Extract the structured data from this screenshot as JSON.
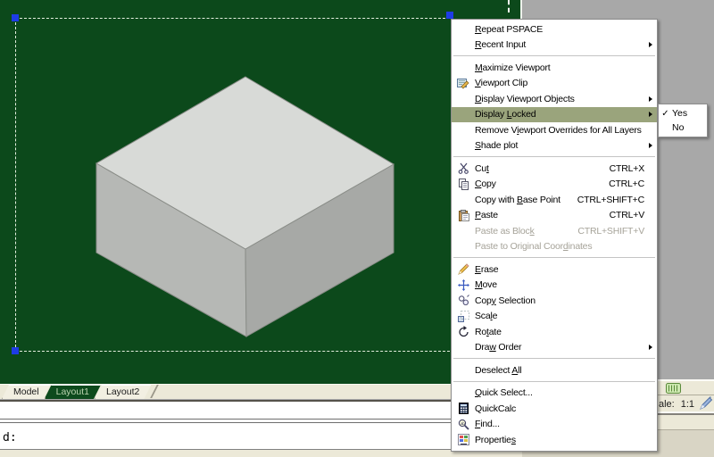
{
  "colors": {
    "viewport_green": "#0c491b",
    "outside_gray": "#a8a8a8",
    "menu_highlight": "#9aa47c",
    "grip_blue": "#1e3ce6",
    "taskbar_beige": "#ece9d8",
    "box_top": "#d8dad7",
    "box_left": "#b6b8b5",
    "box_right": "#a7a9a6",
    "tab_active_bg": "#0d4a1d",
    "tab_active_text": "#bcd3b0"
  },
  "context_menu": {
    "items": [
      {
        "label": "Repeat PSPACE",
        "u": 0
      },
      {
        "label": "Recent Input",
        "u": 0,
        "submenu": true,
        "sep_after": true
      },
      {
        "label": "Maximize Viewport",
        "u": 0
      },
      {
        "label": "Viewport Clip",
        "u": 0,
        "icon": "viewport-clip"
      },
      {
        "label": "Display Viewport Objects",
        "u": 0,
        "submenu": true
      },
      {
        "label": "Display Locked",
        "u": 8,
        "submenu": true,
        "highlighted": true
      },
      {
        "label": "Remove Viewport Overrides for All Layers",
        "u": 8
      },
      {
        "label": "Shade plot",
        "u": 0,
        "submenu": true,
        "sep_after": true
      },
      {
        "label": "Cut",
        "u": 2,
        "icon": "cut",
        "shortcut": "CTRL+X"
      },
      {
        "label": "Copy",
        "u": 0,
        "icon": "copy",
        "shortcut": "CTRL+C"
      },
      {
        "label": "Copy with Base Point",
        "u": 10,
        "shortcut": "CTRL+SHIFT+C"
      },
      {
        "label": "Paste",
        "u": 0,
        "icon": "paste",
        "shortcut": "CTRL+V"
      },
      {
        "label": "Paste as Block",
        "u": 13,
        "shortcut": "CTRL+SHIFT+V",
        "disabled": true
      },
      {
        "label": "Paste to Original Coordinates",
        "u": 22,
        "disabled": true,
        "sep_after": true
      },
      {
        "label": "Erase",
        "u": 0,
        "icon": "erase"
      },
      {
        "label": "Move",
        "u": 0,
        "icon": "move"
      },
      {
        "label": "Copy Selection",
        "u": 3,
        "icon": "copy-selection"
      },
      {
        "label": "Scale",
        "u": 3,
        "icon": "scale"
      },
      {
        "label": "Rotate",
        "u": 2,
        "icon": "rotate"
      },
      {
        "label": "Draw Order",
        "u": 3,
        "submenu": true,
        "sep_after": true
      },
      {
        "label": "Deselect All",
        "u": 9,
        "sep_after": true
      },
      {
        "label": "Quick Select...",
        "u": 0
      },
      {
        "label": "QuickCalc",
        "u": -1,
        "icon": "quickcalc"
      },
      {
        "label": "Find...",
        "u": 0,
        "icon": "find"
      },
      {
        "label": "Properties",
        "u": 9,
        "icon": "properties"
      }
    ]
  },
  "submenu": {
    "items": [
      {
        "label": "Yes",
        "checked": true
      },
      {
        "label": "No",
        "checked": false
      }
    ]
  },
  "layout_tabs": {
    "tabs": [
      {
        "label": "Model",
        "active": false
      },
      {
        "label": "Layout1",
        "active": true
      },
      {
        "label": "Layout2",
        "active": false
      }
    ]
  },
  "command_line": {
    "text": "d:"
  },
  "status_bar": {
    "scale_label": "ale:",
    "scale_value": "1:1"
  }
}
